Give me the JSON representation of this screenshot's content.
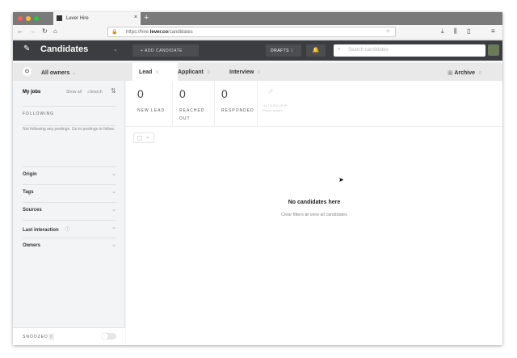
{
  "browser": {
    "tab_title": "Lever Hire",
    "url_prefix": "https://hire.",
    "url_domain": "lever.co",
    "url_path": "/candidates",
    "close": "×",
    "new_tab": "+"
  },
  "header": {
    "title": "Candidates",
    "add_candidate": "+ ADD CANDIDATE",
    "drafts": "DRAFTS",
    "drafts_count": "1",
    "search_placeholder": "Search candidates"
  },
  "subheader": {
    "owners": "All owners",
    "tabs": [
      {
        "label": "Lead",
        "count": "0"
      },
      {
        "label": "Applicant",
        "count": "0"
      },
      {
        "label": "Interview",
        "count": "0"
      }
    ],
    "archive": "Archive",
    "archive_count": "0"
  },
  "sidebar": {
    "my_jobs": "My jobs",
    "show_all": "Show all",
    "search": "Search",
    "following": "FOLLOWING",
    "following_text": "Not following any postings.",
    "go_to": "Go to postings",
    "follow_tail": "to follow.",
    "filters": [
      "Origin",
      "Tags",
      "Sources",
      "Last interaction",
      "Owners"
    ],
    "snoozed": "SNOOZED",
    "snoozed_count": "0"
  },
  "stages": [
    {
      "count": "0",
      "label": "NEW LEAD"
    },
    {
      "count": "0",
      "label": "REACHED OUT"
    },
    {
      "count": "0",
      "label": "RESPONDED"
    },
    {
      "count": "",
      "label": "INTERVIEW",
      "sub": "Phone screen"
    }
  ],
  "empty": {
    "title": "No candidates here",
    "clear": "Clear filters",
    "or": "or",
    "view_all": "view all candidates"
  }
}
